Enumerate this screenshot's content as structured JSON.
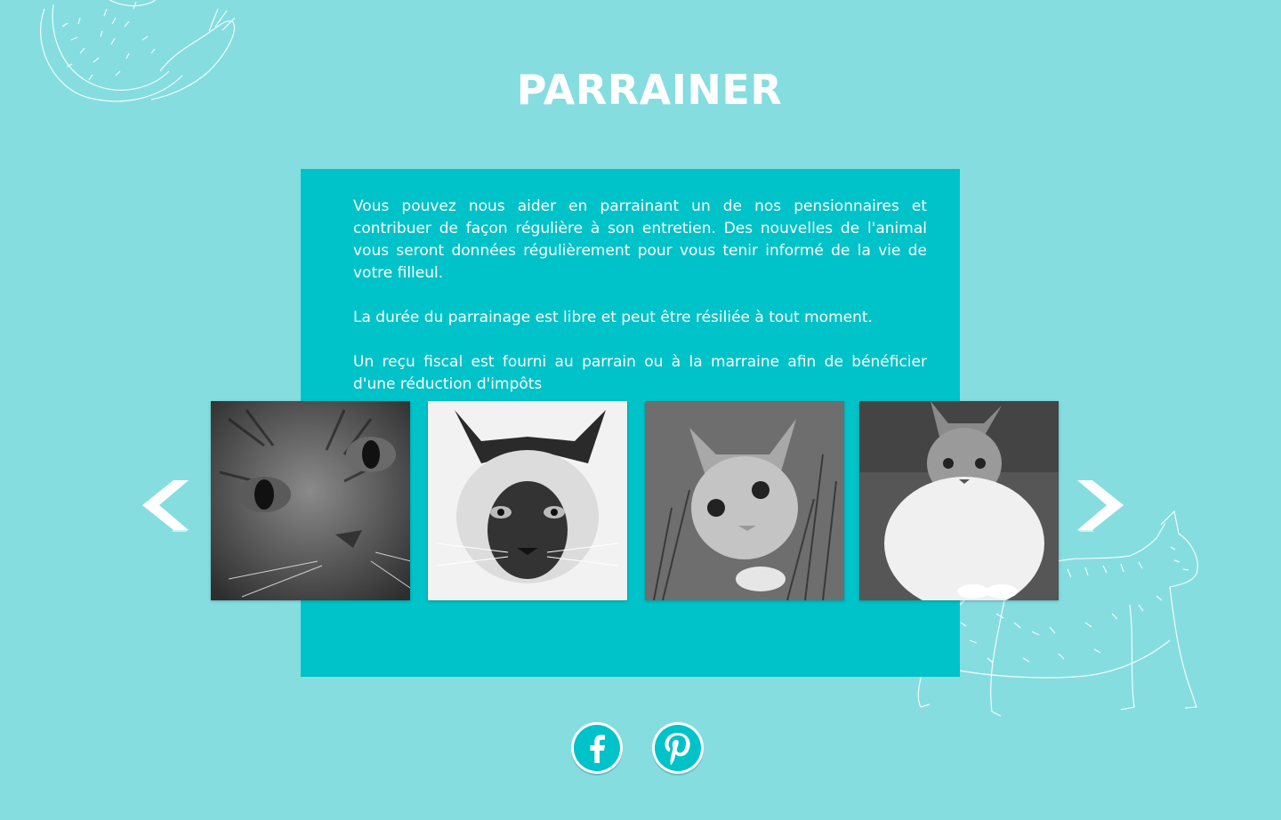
{
  "page": {
    "title": "PARRAINER"
  },
  "content": {
    "paragraphs": [
      "Vous pouvez nous aider en parrainant un de nos pensionnaires et contribuer de façon régulière à son entretien. Des nouvelles de l'animal vous seront données régulièrement pour vous tenir informé de la vie de votre filleul.",
      "La durée du parrainage est libre et peut être résiliée à tout moment.",
      "Un reçu fiscal est fourni au parrain ou à la marraine afin de bénéficier d'une réduction d'impôts"
    ]
  },
  "carousel": {
    "prev_icon": "chevron-left-icon",
    "next_icon": "chevron-right-icon",
    "slides": [
      {
        "alt": "tabby-cat-closeup-photo"
      },
      {
        "alt": "siamese-cat-photo"
      },
      {
        "alt": "kitten-in-grass-photo"
      },
      {
        "alt": "white-tabby-cat-sitting-photo"
      }
    ]
  },
  "social": {
    "facebook_icon": "facebook-icon",
    "pinterest_icon": "pinterest-icon"
  },
  "colors": {
    "background": "#85dde0",
    "panel": "#00c2c9",
    "text": "#ffffff"
  }
}
